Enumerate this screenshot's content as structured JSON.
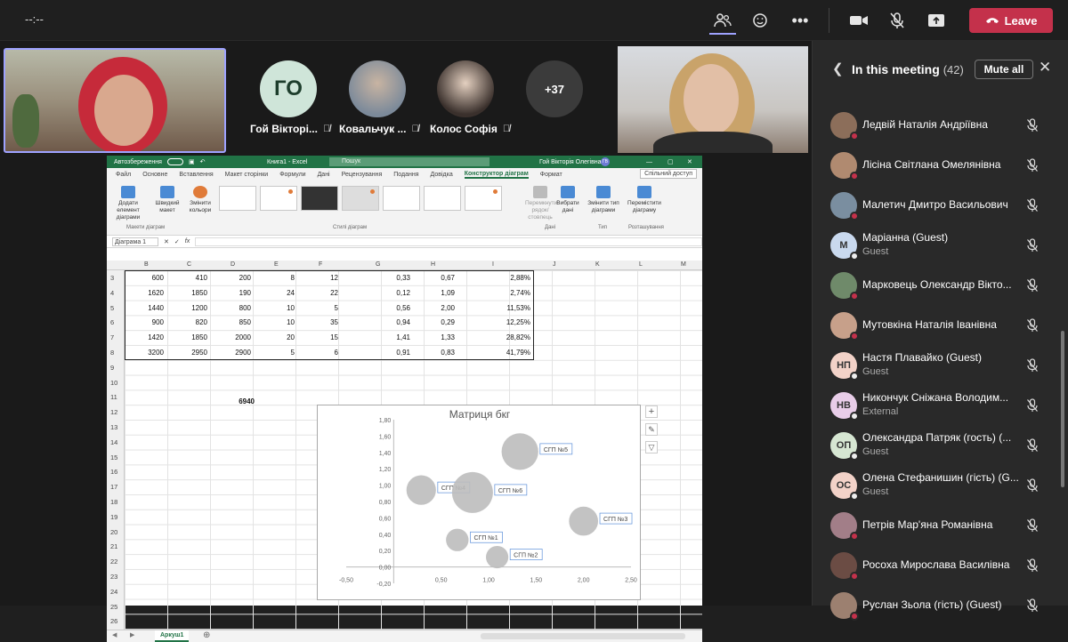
{
  "topbar": {
    "timer": "--:--",
    "leave_label": "Leave"
  },
  "stage": {
    "tiles": [
      {
        "initials": "ГО",
        "name": "Гой Вікторі..."
      },
      {
        "name": "Ковальчук ..."
      },
      {
        "name": "Колос Софія"
      },
      {
        "more": "+37"
      }
    ]
  },
  "excel": {
    "title": "Книга1 - Excel",
    "autosave": "Автозбереження",
    "search": "Пошук",
    "user": "Гой Вікторія Олегівна",
    "user_initials": "ГВ",
    "tabs": [
      "Файл",
      "Основне",
      "Вставлення",
      "Макет сторінки",
      "Формули",
      "Дані",
      "Рецензування",
      "Подання",
      "Довідка",
      "Конструктор діаграм",
      "Формат"
    ],
    "share": "Спільний доступ",
    "ribbon": {
      "add_element": "Додати елемент діаграми",
      "quick_layout": "Швидкий макет",
      "change_colors": "Змінити кольори",
      "switch": "Перемкнути рядок/ стовпець",
      "select_data": "Вибрати дані",
      "change_type": "Змінити тип діаграми",
      "move_chart": "Перемістити діаграму",
      "group_layouts": "Макети діаграм",
      "group_styles": "Стилі діаграм",
      "group_data": "Дані",
      "group_type": "Тип",
      "group_location": "Розташування"
    },
    "namebox": "Діаграма 1",
    "columns": [
      "B",
      "C",
      "D",
      "E",
      "F",
      "G",
      "H",
      "I",
      "J",
      "K",
      "L",
      "M"
    ],
    "rows": [
      "3",
      "4",
      "5",
      "6",
      "7",
      "8",
      "9",
      "10",
      "11",
      "12",
      "13",
      "14",
      "15",
      "16",
      "17",
      "18",
      "19",
      "20",
      "21",
      "22",
      "23",
      "24",
      "25",
      "26"
    ],
    "table": [
      [
        "600",
        "410",
        "200",
        "8",
        "12",
        "0,33",
        "0,67",
        "2,88%"
      ],
      [
        "1620",
        "1850",
        "190",
        "24",
        "22",
        "0,12",
        "1,09",
        "2,74%"
      ],
      [
        "1440",
        "1200",
        "800",
        "10",
        "5",
        "0,56",
        "2,00",
        "11,53%"
      ],
      [
        "900",
        "820",
        "850",
        "10",
        "35",
        "0,94",
        "0,29",
        "12,25%"
      ],
      [
        "1420",
        "1850",
        "2000",
        "20",
        "15",
        "1,41",
        "1,33",
        "28,82%"
      ],
      [
        "3200",
        "2950",
        "2900",
        "5",
        "6",
        "0,91",
        "0,83",
        "41,79%"
      ]
    ],
    "total": "6940",
    "sheet": "Аркуш1"
  },
  "chart_data": {
    "type": "scatter",
    "title": "Матриця бкг",
    "xlim": [
      -0.5,
      2.5
    ],
    "ylim": [
      -0.2,
      1.8
    ],
    "xticks": [
      "-0,50",
      "0,50",
      "1,00",
      "1,50",
      "2,00",
      "2,50"
    ],
    "yticks": [
      "-0,20",
      "0,00",
      "0,20",
      "0,40",
      "0,60",
      "0,80",
      "1,00",
      "1,20",
      "1,40",
      "1,60",
      "1,80"
    ],
    "points": [
      {
        "label": "СГП №1",
        "x": 0.67,
        "y": 0.33,
        "size": 2.88
      },
      {
        "label": "СГП №2",
        "x": 1.09,
        "y": 0.12,
        "size": 2.74
      },
      {
        "label": "СГП №3",
        "x": 2.0,
        "y": 0.56,
        "size": 11.53
      },
      {
        "label": "СГП №4",
        "x": 0.29,
        "y": 0.94,
        "size": 12.25
      },
      {
        "label": "СГП №5",
        "x": 1.33,
        "y": 1.41,
        "size": 28.82
      },
      {
        "label": "СГП №6",
        "x": 0.83,
        "y": 0.91,
        "size": 41.79
      }
    ],
    "grid": false
  },
  "panel": {
    "title": "In this meeting",
    "count": "(42)",
    "mute_all": "Mute all",
    "people": [
      {
        "name": "Ледвій Наталія Андріївна",
        "sub": "",
        "initials": "",
        "color": "#8c6e5a"
      },
      {
        "name": "Лісіна Світлана Омелянівна",
        "sub": "",
        "initials": "",
        "color": "#b08a70"
      },
      {
        "name": "Малетич Дмитро Васильович",
        "sub": "",
        "initials": "",
        "color": "#7a8ea0"
      },
      {
        "name": "Маріанна (Guest)",
        "sub": "Guest",
        "initials": "М",
        "color": "#c9d9ee"
      },
      {
        "name": "Марковець Олександр Вікто...",
        "sub": "",
        "initials": "",
        "color": "#6f8a6a"
      },
      {
        "name": "Мутовкіна Наталія Іванівна",
        "sub": "",
        "initials": "",
        "color": "#c7a08a"
      },
      {
        "name": "Настя Плавайко (Guest)",
        "sub": "Guest",
        "initials": "НП",
        "color": "#f2d2c8"
      },
      {
        "name": "Никончук Сніжана Володим...",
        "sub": "External",
        "initials": "НВ",
        "color": "#e8cde8"
      },
      {
        "name": "Олександра Патряк (гость) (...",
        "sub": "Guest",
        "initials": "ОП",
        "color": "#d6e6d2"
      },
      {
        "name": "Олена Стефанишин (гість) (G...",
        "sub": "Guest",
        "initials": "ОС",
        "color": "#f2d2c8"
      },
      {
        "name": "Петрів Мар'яна Романівна",
        "sub": "",
        "initials": "",
        "color": "#a27e88"
      },
      {
        "name": "Росоха Мирослава Василівна",
        "sub": "",
        "initials": "",
        "color": "#6b4c44"
      },
      {
        "name": "Руслан Зьола (гість) (Guest)",
        "sub": "",
        "initials": "",
        "color": "#9c8070"
      }
    ]
  }
}
